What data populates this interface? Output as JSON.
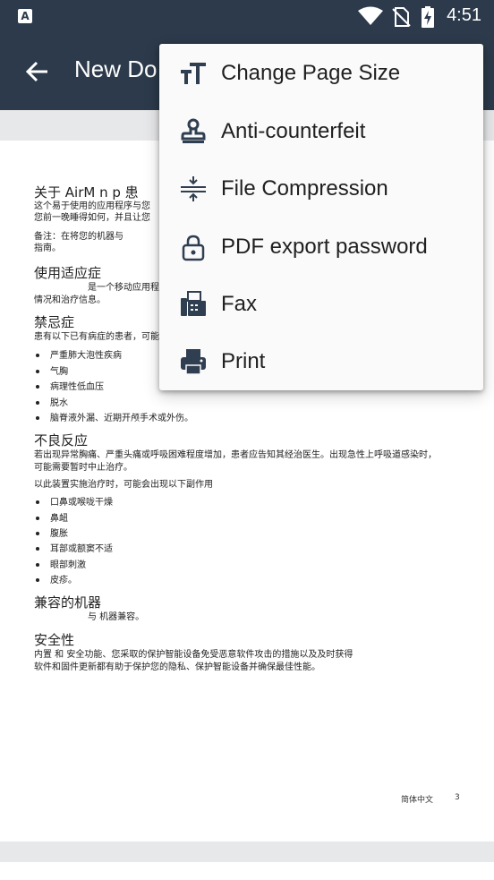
{
  "status_bar": {
    "app_icon_letter": "A",
    "time": "4:51",
    "icons": [
      "wifi-icon",
      "no-sim-icon",
      "battery-charging-icon"
    ]
  },
  "app_bar": {
    "back_icon": "arrow-back-icon",
    "title": "New Do"
  },
  "menu": {
    "items": [
      {
        "label": "Change Page Size",
        "icon": "text-size-icon"
      },
      {
        "label": "Anti-counterfeit",
        "icon": "stamp-icon"
      },
      {
        "label": "File Compression",
        "icon": "compress-icon"
      },
      {
        "label": "PDF export password",
        "icon": "lock-icon"
      },
      {
        "label": "Fax",
        "icon": "fax-icon"
      },
      {
        "label": "Print",
        "icon": "print-icon"
      }
    ]
  },
  "document": {
    "heading_about": "关于 AirM n    p   患",
    "about_line1": "这个易于使用的应用程序与您",
    "about_line2": "您前一晚睡得如何，并且让您",
    "note_line1": "备注：在将您的机器与",
    "note_line2": "指南。",
    "heading_indications": "使用适应症",
    "indications_line1": "是一个移动应用程",
    "indications_line2": "情况和治疗信息。",
    "heading_contraindications": "禁忌症",
    "contraindications_intro": "患有以下已有病症的患者，可能",
    "contraindications_list": [
      "严重肺大泡性疾病",
      "气胸",
      "病理性低血压",
      "脱水",
      "脑脊液外漏、近期开颅手术或外伤。"
    ],
    "heading_adverse": "不良反应",
    "adverse_line1": "若出现异常胸痛、严重头痛或呼吸困难程度增加，患者应告知其经治医生。出现急性上呼吸道感染时，",
    "adverse_line2": "可能需要暂时中止治疗。",
    "adverse_intro": "以此装置实施治疗时，可能会出现以下副作用",
    "adverse_list": [
      "口鼻或喉咙干燥",
      "鼻衄",
      "腹胀",
      "耳部或额窦不适",
      "眼部刺激",
      "皮疹。"
    ],
    "heading_compatible": "兼容的机器",
    "compatible_line": "与              机器兼容。",
    "heading_security": "安全性",
    "security_line1": "内置               和                       安全功能、您采取的保护智能设备免受恶意软件攻击的措施以及及时获得",
    "security_line2": "软件和固件更新都有助于保护您的隐私、保护智能设备并确保最佳性能。",
    "footer_lang": "简体中文",
    "footer_page": "3"
  },
  "colors": {
    "app_bar": "#2c3a4b",
    "menu_icon": "#2f3e50",
    "page_gap": "#e7e8e9"
  }
}
